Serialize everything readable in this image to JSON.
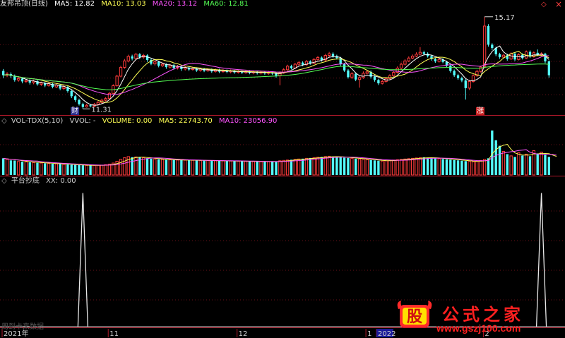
{
  "price_panel": {
    "title": "友邦吊顶(日线)",
    "ma5": "MA5: 12.82",
    "ma10": "MA10: 13.03",
    "ma20": "MA20: 13.12",
    "ma60": "MA60: 12.81",
    "high_label": "15.17",
    "low_label": "11.31",
    "marker_cai": "财",
    "marker_zhang": "涨"
  },
  "volume_panel": {
    "title": "VOL-TDX(5,10)",
    "vvol": "VVOL: -",
    "volume": "VOLUME: 0.00",
    "ma5": "MA5: 22743.70",
    "ma10": "MA10: 23056.90"
  },
  "indicator_panel": {
    "title": "平台抄底",
    "xx": "XX: 0.00"
  },
  "x_axis": {
    "labels": [
      "2021年",
      "11",
      "12",
      "1",
      "2",
      "2022"
    ]
  },
  "window_controls": {
    "up": "◇",
    "close": "×"
  },
  "watermark": {
    "logo_char": "股",
    "text": "公式之家",
    "url": "www.gszj100.com"
  },
  "faint_note": "周到卡来数据",
  "colors": {
    "up": "#ff3b3b",
    "down": "#54ffff",
    "ma5": "#ffffff",
    "ma10": "#ffff54",
    "ma20": "#ff54ff",
    "ma60": "#54ff54",
    "separator": "#b0182a"
  },
  "chart_data": {
    "type": "candlestick",
    "price": {
      "candles": [
        [
          12.9,
          12.72,
          12.98,
          12.6
        ],
        [
          12.72,
          12.77,
          12.85,
          12.64
        ],
        [
          12.77,
          12.69,
          12.84,
          12.6
        ],
        [
          12.69,
          12.52,
          12.75,
          12.45
        ],
        [
          12.52,
          12.58,
          12.66,
          12.45
        ],
        [
          12.58,
          12.46,
          12.64,
          12.38
        ],
        [
          12.46,
          12.5,
          12.56,
          12.39
        ],
        [
          12.5,
          12.41,
          12.55,
          12.33
        ],
        [
          12.41,
          12.47,
          12.53,
          12.34
        ],
        [
          12.47,
          12.34,
          12.52,
          12.28
        ],
        [
          12.34,
          12.39,
          12.45,
          12.27
        ],
        [
          12.39,
          12.29,
          12.44,
          12.22
        ],
        [
          12.29,
          12.36,
          12.42,
          12.24
        ],
        [
          12.36,
          12.23,
          12.4,
          12.17
        ],
        [
          12.23,
          12.31,
          12.37,
          12.18
        ],
        [
          12.31,
          12.16,
          12.35,
          12.09
        ],
        [
          12.16,
          12.23,
          12.29,
          12.1
        ],
        [
          12.23,
          12.06,
          12.27,
          11.99
        ],
        [
          12.06,
          11.84,
          12.11,
          11.76
        ],
        [
          11.84,
          11.68,
          11.9,
          11.6
        ],
        [
          11.68,
          11.51,
          11.74,
          11.45
        ],
        [
          11.51,
          11.39,
          11.57,
          11.31
        ],
        [
          11.39,
          11.46,
          11.53,
          11.36
        ],
        [
          11.46,
          11.42,
          11.52,
          11.37
        ],
        [
          11.42,
          11.5,
          11.56,
          11.38
        ],
        [
          11.5,
          11.58,
          11.64,
          11.46
        ],
        [
          11.58,
          11.67,
          11.74,
          11.54
        ],
        [
          11.67,
          11.74,
          11.8,
          11.62
        ],
        [
          11.74,
          11.96,
          12.02,
          11.7
        ],
        [
          11.96,
          12.28,
          12.34,
          11.93
        ],
        [
          12.28,
          12.68,
          12.74,
          12.24
        ],
        [
          12.68,
          13.05,
          13.12,
          12.63
        ],
        [
          13.05,
          13.32,
          13.4,
          12.99
        ],
        [
          13.32,
          13.51,
          13.58,
          13.26
        ],
        [
          13.51,
          13.42,
          13.58,
          13.34
        ],
        [
          13.42,
          13.6,
          13.66,
          13.37
        ],
        [
          13.6,
          13.48,
          13.65,
          13.4
        ],
        [
          13.48,
          13.55,
          13.62,
          13.41
        ],
        [
          13.55,
          13.36,
          13.6,
          13.28
        ],
        [
          13.36,
          13.2,
          13.42,
          13.14
        ],
        [
          13.2,
          13.28,
          13.34,
          13.13
        ],
        [
          13.28,
          13.12,
          13.33,
          13.05
        ],
        [
          13.12,
          13.18,
          13.25,
          13.06
        ],
        [
          13.18,
          13.06,
          13.22,
          12.99
        ],
        [
          13.06,
          13.14,
          13.2,
          13.0
        ],
        [
          13.14,
          13.02,
          13.19,
          12.95
        ],
        [
          13.02,
          13.08,
          13.15,
          12.96
        ],
        [
          13.08,
          12.98,
          13.13,
          12.9
        ],
        [
          12.98,
          13.04,
          13.1,
          12.92
        ],
        [
          13.04,
          12.96,
          13.09,
          12.9
        ],
        [
          12.96,
          13.0,
          13.06,
          12.91
        ],
        [
          13.0,
          12.92,
          13.05,
          12.86
        ],
        [
          12.92,
          12.98,
          13.04,
          12.87
        ],
        [
          12.98,
          12.91,
          13.03,
          12.85
        ],
        [
          12.91,
          12.96,
          13.02,
          12.86
        ],
        [
          12.96,
          12.88,
          13.0,
          12.82
        ],
        [
          12.88,
          12.94,
          13.0,
          12.83
        ],
        [
          12.94,
          12.87,
          12.99,
          12.81
        ],
        [
          12.87,
          12.92,
          12.98,
          12.82
        ],
        [
          12.92,
          12.86,
          12.96,
          12.8
        ],
        [
          12.86,
          12.9,
          12.96,
          12.8
        ],
        [
          12.9,
          12.84,
          12.94,
          12.78
        ],
        [
          12.84,
          12.88,
          12.94,
          12.79
        ],
        [
          12.88,
          12.83,
          12.92,
          12.77
        ],
        [
          12.83,
          12.87,
          12.93,
          12.78
        ],
        [
          12.87,
          12.82,
          12.91,
          12.76
        ],
        [
          12.82,
          12.86,
          12.92,
          12.76
        ],
        [
          12.86,
          12.81,
          12.9,
          12.75
        ],
        [
          12.81,
          12.85,
          12.91,
          12.75
        ],
        [
          12.85,
          12.8,
          12.89,
          12.74
        ],
        [
          12.8,
          12.84,
          12.9,
          12.74
        ],
        [
          12.84,
          12.79,
          12.88,
          12.73
        ],
        [
          12.79,
          12.7,
          12.84,
          12.62
        ],
        [
          12.7,
          12.82,
          12.88,
          12.3
        ],
        [
          12.82,
          12.95,
          13.02,
          12.78
        ],
        [
          12.95,
          13.1,
          13.16,
          12.9
        ],
        [
          13.1,
          13.02,
          13.16,
          12.96
        ],
        [
          13.02,
          13.18,
          13.24,
          12.98
        ],
        [
          13.18,
          13.25,
          13.31,
          13.12
        ],
        [
          13.25,
          13.16,
          13.3,
          13.1
        ],
        [
          13.16,
          13.3,
          13.36,
          13.12
        ],
        [
          13.3,
          13.22,
          13.35,
          13.16
        ],
        [
          13.22,
          13.38,
          13.44,
          13.18
        ],
        [
          13.38,
          13.46,
          13.53,
          13.33
        ],
        [
          13.46,
          13.36,
          13.51,
          13.29
        ],
        [
          13.36,
          13.55,
          13.62,
          13.31
        ],
        [
          13.55,
          13.62,
          13.7,
          13.49
        ],
        [
          13.62,
          13.52,
          13.68,
          13.45
        ],
        [
          13.52,
          13.44,
          13.58,
          13.38
        ],
        [
          13.44,
          13.18,
          13.49,
          13.1
        ],
        [
          13.18,
          12.92,
          13.24,
          12.86
        ],
        [
          12.92,
          12.64,
          12.98,
          12.58
        ],
        [
          12.64,
          12.78,
          12.85,
          12.56
        ],
        [
          12.78,
          12.54,
          12.84,
          12.47
        ],
        [
          12.54,
          12.62,
          12.7,
          12.2
        ],
        [
          12.62,
          12.8,
          12.88,
          12.57
        ],
        [
          12.8,
          12.86,
          12.93,
          12.75
        ],
        [
          12.86,
          12.66,
          12.92,
          12.58
        ],
        [
          12.66,
          12.52,
          12.72,
          12.45
        ],
        [
          12.52,
          12.38,
          12.57,
          12.31
        ],
        [
          12.38,
          12.46,
          12.53,
          12.33
        ],
        [
          12.46,
          12.58,
          12.64,
          12.41
        ],
        [
          12.58,
          12.7,
          12.76,
          12.53
        ],
        [
          12.7,
          12.84,
          12.91,
          12.66
        ],
        [
          12.84,
          13.02,
          13.09,
          12.79
        ],
        [
          13.02,
          13.18,
          13.25,
          12.96
        ],
        [
          13.18,
          13.32,
          13.39,
          13.13
        ],
        [
          13.32,
          13.44,
          13.51,
          13.27
        ],
        [
          13.44,
          13.52,
          13.59,
          13.39
        ],
        [
          13.52,
          13.6,
          13.68,
          13.47
        ],
        [
          13.6,
          13.68,
          13.9,
          13.55
        ],
        [
          13.68,
          13.62,
          13.75,
          13.56
        ],
        [
          13.62,
          13.52,
          13.68,
          13.46
        ],
        [
          13.52,
          13.4,
          13.58,
          13.33
        ],
        [
          13.4,
          13.3,
          13.46,
          13.24
        ],
        [
          13.3,
          13.38,
          13.44,
          13.25
        ],
        [
          13.38,
          13.28,
          13.43,
          13.22
        ],
        [
          13.28,
          13.12,
          13.33,
          13.06
        ],
        [
          13.12,
          12.9,
          13.17,
          12.83
        ],
        [
          12.9,
          12.72,
          12.96,
          12.65
        ],
        [
          12.72,
          12.6,
          12.78,
          12.53
        ],
        [
          12.6,
          12.5,
          12.66,
          12.43
        ],
        [
          12.5,
          12.18,
          12.56,
          11.7
        ],
        [
          12.18,
          12.46,
          12.52,
          12.1
        ],
        [
          12.46,
          12.7,
          12.76,
          12.41
        ],
        [
          12.7,
          12.88,
          12.95,
          12.65
        ],
        [
          12.88,
          13.06,
          13.12,
          12.83
        ],
        [
          13.06,
          14.78,
          15.17,
          13.0
        ],
        [
          14.78,
          14.0,
          14.86,
          13.92
        ],
        [
          14.0,
          13.86,
          14.06,
          13.78
        ],
        [
          13.86,
          13.6,
          13.92,
          13.52
        ],
        [
          13.6,
          13.48,
          13.66,
          13.41
        ],
        [
          13.48,
          13.56,
          13.62,
          13.43
        ],
        [
          13.56,
          13.4,
          13.62,
          13.33
        ],
        [
          13.4,
          13.62,
          13.68,
          13.36
        ],
        [
          13.62,
          13.38,
          13.68,
          13.31
        ],
        [
          13.38,
          13.58,
          13.64,
          13.34
        ],
        [
          13.58,
          13.44,
          13.64,
          13.38
        ],
        [
          13.44,
          13.7,
          13.76,
          13.4
        ],
        [
          13.7,
          13.5,
          13.76,
          13.44
        ],
        [
          13.5,
          13.66,
          13.72,
          13.46
        ],
        [
          13.66,
          13.58,
          13.8,
          13.52
        ],
        [
          13.58,
          13.62,
          13.68,
          13.54
        ],
        [
          13.62,
          13.3,
          13.66,
          13.22
        ],
        [
          13.3,
          12.72,
          13.34,
          12.62
        ]
      ],
      "ylim": [
        11.2,
        15.4
      ],
      "annotations": [
        {
          "text": "15.17",
          "value": 15.17
        },
        {
          "text": "11.31",
          "value": 11.31
        }
      ]
    },
    "volume": {
      "values": [
        24000,
        22500,
        21000,
        20800,
        19500,
        19200,
        18800,
        18200,
        17900,
        17600,
        17200,
        16800,
        16600,
        16300,
        16000,
        15700,
        15400,
        15100,
        14800,
        14500,
        14200,
        14000,
        13800,
        13700,
        13800,
        14000,
        14200,
        14800,
        15600,
        17200,
        19800,
        22500,
        24800,
        26500,
        25600,
        26000,
        25500,
        24800,
        24200,
        23500,
        23000,
        22600,
        22300,
        22000,
        21800,
        21600,
        21500,
        21400,
        21300,
        21200,
        21100,
        21000,
        20900,
        20800,
        20700,
        20600,
        20500,
        20400,
        20300,
        20200,
        20100,
        20000,
        19900,
        19800,
        19700,
        19600,
        19500,
        19400,
        19300,
        19200,
        19100,
        19000,
        19500,
        20500,
        21000,
        21500,
        22000,
        22500,
        23000,
        23500,
        24000,
        24500,
        25000,
        25500,
        26000,
        26500,
        27000,
        26500,
        26000,
        25500,
        25000,
        24500,
        24000,
        23500,
        23000,
        22500,
        22000,
        21500,
        21000,
        20500,
        20000,
        20500,
        21000,
        21500,
        22000,
        22500,
        23000,
        23500,
        24000,
        24500,
        25000,
        25500,
        25000,
        24500,
        24000,
        23500,
        23000,
        22500,
        22000,
        21500,
        21000,
        20500,
        20000,
        19500,
        19000,
        19500,
        21000,
        22500,
        24000,
        64000,
        50000,
        42000,
        34000,
        30000,
        27500,
        26000,
        32000,
        28000,
        30000,
        27000,
        35000,
        31000,
        33000,
        29000,
        26000,
        24000,
        22000
      ],
      "ylim": [
        0,
        68000
      ]
    },
    "indicator": {
      "spikes": [
        {
          "bar": 21,
          "value": 1
        },
        {
          "bar": 142,
          "value": 1
        }
      ],
      "ylim": [
        0,
        1.05
      ]
    }
  }
}
